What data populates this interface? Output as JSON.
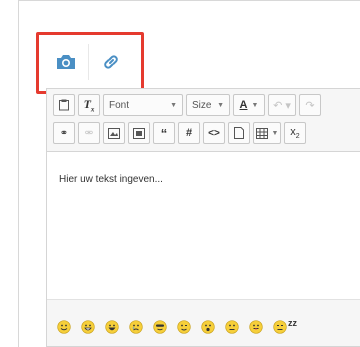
{
  "media_toolbar": {
    "buttons": [
      {
        "name": "camera-button",
        "icon": "camera-icon"
      },
      {
        "name": "link-button",
        "icon": "link-icon"
      }
    ],
    "highlight_color": "#e53a2f",
    "icon_color": "#4a8fc4"
  },
  "toolbar_row1": {
    "font_label": "Font",
    "size_label": "Size",
    "font_color_label": "A"
  },
  "editor": {
    "placeholder": "Hier uw tekst ingeven..."
  },
  "smileys": [
    "smile",
    "grin",
    "laugh",
    "cry",
    "cool",
    "wink",
    "surprised",
    "neutral",
    "tongue",
    "sleep"
  ],
  "sleep_text": "zz"
}
